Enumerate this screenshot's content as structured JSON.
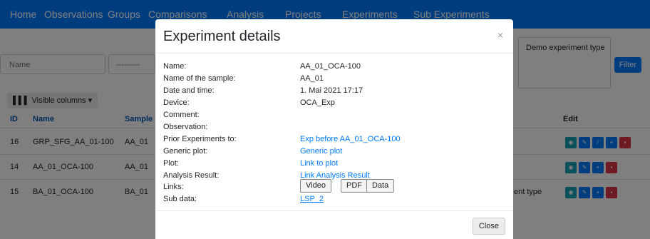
{
  "navbar": {
    "items": [
      "Home",
      "Observations",
      "Groups",
      "Comparisons",
      "Analysis",
      "Projects",
      "Experiments",
      "Sub Experiments"
    ]
  },
  "filters": {
    "name_placeholder": "Name",
    "select_value": "---------",
    "type_value": "Demo experiment type",
    "filter_label": "Filter"
  },
  "table": {
    "visible_columns_label": "Visible columns",
    "headers": {
      "id": "ID",
      "name": "Name",
      "sample": "Sample n",
      "edit": "Edit"
    },
    "rows": [
      {
        "id": "16",
        "name": "GRP_SFG_AA_01-100",
        "sample": "AA_01",
        "type": ""
      },
      {
        "id": "14",
        "name": "AA_01_OCA-100",
        "sample": "AA_01",
        "type": ""
      },
      {
        "id": "15",
        "name": "BA_01_OCA-100",
        "sample": "BA_01",
        "type": "ent type"
      }
    ]
  },
  "modal": {
    "title": "Experiment details",
    "close_symbol": "×",
    "fields": {
      "name_label": "Name:",
      "name_value": "AA_01_OCA-100",
      "sample_label": "Name of the sample:",
      "sample_value": "AA_01",
      "date_label": "Date and time:",
      "date_value": "1. Mai 2021 17:17",
      "device_label": "Device:",
      "device_value": "OCA_Exp",
      "comment_label": "Comment:",
      "observation_label": "Observation:",
      "prior_label": "Prior Experiments to:",
      "prior_value": "Exp before AA_01_OCA-100",
      "generic_label": "Generic plot:",
      "generic_value": "Generic plot",
      "plot_label": "Plot:",
      "plot_value": "Link to plot",
      "analysis_label": "Analysis Result:",
      "analysis_value": "Link Analysis Result",
      "links_label": "Links:",
      "subdata_label": "Sub data:",
      "subdata_value": "LSP_2"
    },
    "link_buttons": [
      "Video",
      "PDF",
      "Data"
    ],
    "close_label": "Close"
  },
  "colors": {
    "navbar": "#007bff",
    "link": "#007bff",
    "delete": "#dc3545",
    "view": "#17a2b8"
  }
}
